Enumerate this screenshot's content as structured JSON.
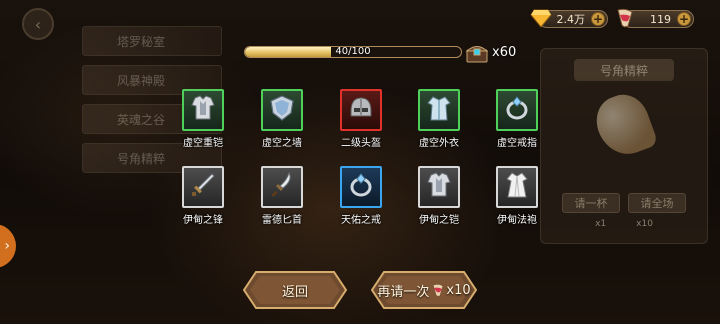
{
  "left_menu": {
    "items": [
      "塔罗秘室",
      "风暴神殿",
      "英魂之谷",
      "号角精粹"
    ]
  },
  "currencies": {
    "gems": "2.4万",
    "horns": "119"
  },
  "progress": {
    "text": "40/100",
    "fraction": 0.4,
    "chest_count": "x60"
  },
  "items": [
    {
      "name": "虚空重铠",
      "rarity": "green",
      "icon": "armor-icon"
    },
    {
      "name": "虚空之墙",
      "rarity": "green",
      "icon": "shield-icon"
    },
    {
      "name": "二级头盔",
      "rarity": "red",
      "icon": "helmet-icon"
    },
    {
      "name": "虚空外衣",
      "rarity": "green",
      "icon": "coat-icon"
    },
    {
      "name": "虚空戒指",
      "rarity": "green",
      "icon": "ring-icon"
    },
    {
      "name": "伊甸之锋",
      "rarity": "white",
      "icon": "sword-icon"
    },
    {
      "name": "雷德匕首",
      "rarity": "white",
      "icon": "dagger-icon"
    },
    {
      "name": "天佑之戒",
      "rarity": "blue",
      "icon": "ring-icon"
    },
    {
      "name": "伊甸之铠",
      "rarity": "white",
      "icon": "armor-icon"
    },
    {
      "name": "伊甸法袍",
      "rarity": "white",
      "icon": "robe-icon"
    }
  ],
  "right_panel": {
    "title": "号角精粹",
    "btn_one": "请一杯",
    "btn_all": "请全场",
    "cost_one": "x1",
    "cost_all": "x10"
  },
  "buttons": {
    "back": "返回",
    "again": "再请一次",
    "again_cost": "x10"
  },
  "colors": {
    "green": "#4fd05a",
    "red": "#e0322b",
    "blue": "#3aa6f0",
    "white": "#d8d8d8",
    "accent_gold": "#c9983d"
  }
}
